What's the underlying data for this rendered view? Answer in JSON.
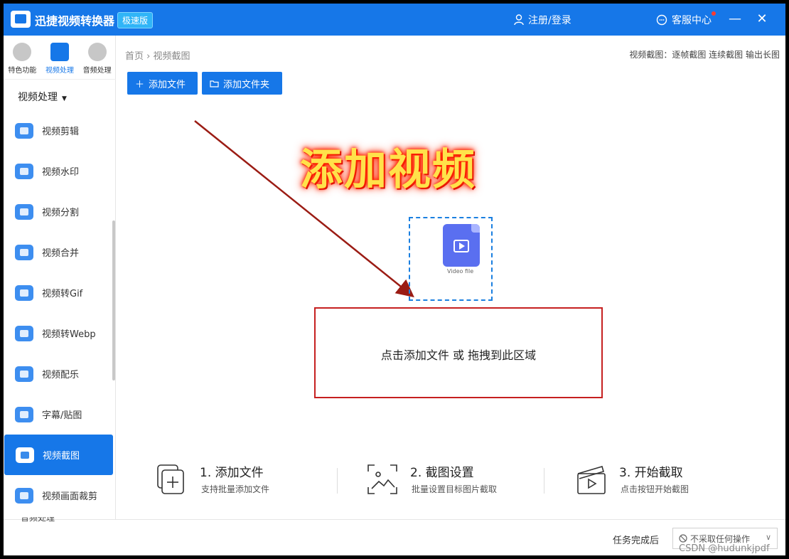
{
  "window": {
    "app_title": "迅捷视频转换器",
    "edition_badge": "极速版",
    "login_label": "注册/登录",
    "support_label": "客服中心",
    "minimize_glyph": "—",
    "close_glyph": "✕"
  },
  "topnav": [
    {
      "label": "特色功能",
      "icon": "star-icon",
      "active": false
    },
    {
      "label": "视频处理",
      "icon": "film-icon",
      "active": true
    },
    {
      "label": "音频处理",
      "icon": "audio-icon",
      "active": false
    }
  ],
  "sidebar": {
    "section_title": "视频处理",
    "items": [
      {
        "label": "视频剪辑",
        "icon": "video-edit-icon",
        "active": false
      },
      {
        "label": "视频水印",
        "icon": "watermark-icon",
        "active": false
      },
      {
        "label": "视频分割",
        "icon": "split-icon",
        "active": false
      },
      {
        "label": "视频合并",
        "icon": "merge-icon",
        "active": false
      },
      {
        "label": "视频转Gif",
        "icon": "gif-icon",
        "active": false
      },
      {
        "label": "视频转Webp",
        "icon": "webp-icon",
        "active": false
      },
      {
        "label": "视频配乐",
        "icon": "music-icon",
        "active": false
      },
      {
        "label": "字幕/贴图",
        "icon": "sticker-icon",
        "active": false
      },
      {
        "label": "视频截图",
        "icon": "screenshot-icon",
        "active": true
      },
      {
        "label": "视频画面裁剪",
        "icon": "crop-icon",
        "active": false
      }
    ],
    "cut_off_label": "音频处理"
  },
  "main": {
    "breadcrumb": {
      "home": "首页",
      "separator": "›",
      "current": "视频截图"
    },
    "shot_modes": "视频截图：逐帧截图 连续截图 输出长图",
    "add_file_button": "添加文件",
    "add_folder_button": "添加文件夹",
    "headline": "添加视频",
    "file_caption": "Video file",
    "drop_hint": "点击添加文件 或 拖拽到此区域",
    "steps": [
      {
        "title": "1. 添加文件",
        "desc": "支持批量添加文件",
        "icon": "add-file-icon"
      },
      {
        "title": "2. 截图设置",
        "desc": "批量设置目标图片截取",
        "icon": "screenshot-settings-icon"
      },
      {
        "title": "3. 开始截取",
        "desc": "点击按钮开始截图",
        "icon": "start-capture-icon"
      }
    ]
  },
  "footer": {
    "after_task_label": "任务完成后",
    "after_task_value": "不采取任何操作",
    "watermark": "CSDN @hudunkjpdf"
  },
  "colors": {
    "brand": "#1677e8",
    "annotation_red": "#c62020",
    "headline_yellow": "#ffe24a"
  }
}
